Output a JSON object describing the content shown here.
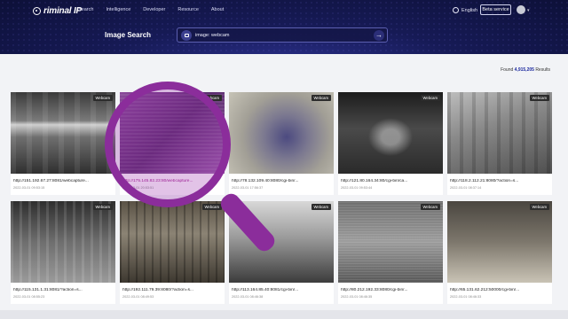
{
  "brand": {
    "logo_text": "riminal IP"
  },
  "nav": {
    "items": [
      "Search",
      "Intelligence",
      "Developer",
      "Resource",
      "About"
    ]
  },
  "header_right": {
    "language": "English",
    "beta_label": "Beta service"
  },
  "page": {
    "title": "Image Search"
  },
  "search": {
    "value": "image: webcam"
  },
  "results": {
    "found_label": "Found",
    "found_count": "4,915,205",
    "found_suffix": "Results"
  },
  "cards": [
    {
      "badge": "Webcam",
      "ip": "http://151.192.67.27:8081/webcapture...",
      "date": "2022-03-01 09:53:15"
    },
    {
      "badge": "Webcam",
      "ip": "http://175.145.82.23:80/webcapture...",
      "date": "2022-03-01 20:53:51"
    },
    {
      "badge": "Webcam",
      "ip": "http://78.132.109.40:8080/cgi-bin/...",
      "date": "2022-03-01 17:56:37"
    },
    {
      "badge": "Webcam",
      "ip": "http://121.80.164.34:80/cgi-bin/ca...",
      "date": "2022-03-01 09:53:44"
    },
    {
      "badge": "Webcam",
      "ip": "http://118.2.112.21:8080/?action=s...",
      "date": "2022-03-01 08:37:14"
    },
    {
      "badge": "Webcam",
      "ip": "http://115.131.1.31:8081/?action=s...",
      "date": "2022-03-01 08:55:23"
    },
    {
      "badge": "Webcam",
      "ip": "http://192.111.79.39:8080/?action=s...",
      "date": "2022-03-01 08:49:53"
    },
    {
      "badge": "Webcam",
      "ip": "http://113.164.85.40:8081/cgi-bin/...",
      "date": "2022-03-01 08:46:38"
    },
    {
      "badge": "Webcam",
      "ip": "http://80.212.192.33:8080/cgi-bin/...",
      "date": "2022-03-01 08:46:35"
    },
    {
      "badge": "Webcam",
      "ip": "http://65.131.62.212:50000/cgi-bin/...",
      "date": "2022-03-01 08:46:33"
    }
  ],
  "colors": {
    "header_dark": "#0d1038",
    "accent": "#1d2a9f",
    "magnifier": "#8b2d9b"
  },
  "icons": {
    "search_prefix": "image-icon",
    "search_go": "arrow-right-icon",
    "language": "globe-icon"
  }
}
